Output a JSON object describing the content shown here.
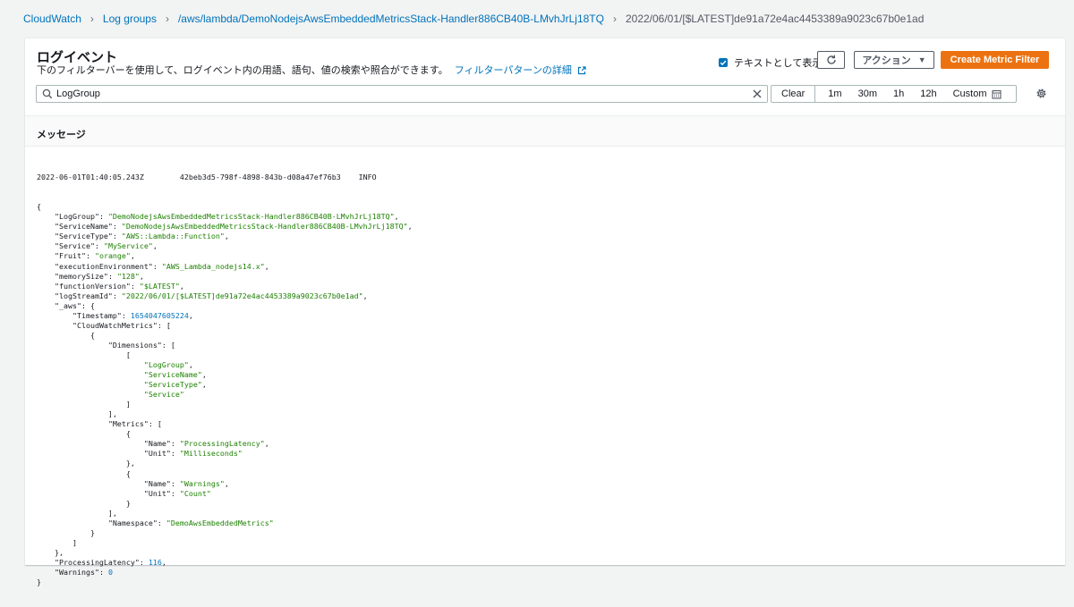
{
  "breadcrumb": {
    "items": [
      "CloudWatch",
      "Log groups",
      "/aws/lambda/DemoNodejsAwsEmbeddedMetricsStack-Handler886CB40B-LMvhJrLj18TQ"
    ],
    "current": "2022/06/01/[$LATEST]de91a72e4ac4453389a9023c67b0e1ad"
  },
  "header": {
    "title": "ログイベント",
    "description": "下のフィルターバーを使用して、ログイベント内の用語、語句、値の検索や照合ができます。",
    "learn_more": "フィルターパターンの詳細",
    "view_as_text": "テキストとして表示",
    "actions_label": "アクション",
    "create_metric_filter": "Create Metric Filter",
    "view_as_text_checked": true
  },
  "filter": {
    "value": "LogGroup",
    "time_buttons": [
      "Clear",
      "1m",
      "30m",
      "1h",
      "12h",
      "Custom"
    ]
  },
  "table": {
    "column": "メッセージ"
  },
  "log": {
    "timestamp": "2022-06-01T01:40:05.243Z",
    "request_id": "42beb3d5-798f-4898-843b-d08a47ef76b3",
    "level": "INFO",
    "lines": [
      [
        [
          "p",
          "{"
        ]
      ],
      [
        [
          "p",
          "    "
        ],
        [
          "k",
          "\"LogGroup\""
        ],
        [
          "p",
          ": "
        ],
        [
          "s",
          "\"DemoNodejsAwsEmbeddedMetricsStack-Handler886CB40B-LMvhJrLj18TQ\""
        ],
        [
          "p",
          ","
        ]
      ],
      [
        [
          "p",
          "    "
        ],
        [
          "k",
          "\"ServiceName\""
        ],
        [
          "p",
          ": "
        ],
        [
          "s",
          "\"DemoNodejsAwsEmbeddedMetricsStack-Handler886CB40B-LMvhJrLj18TQ\""
        ],
        [
          "p",
          ","
        ]
      ],
      [
        [
          "p",
          "    "
        ],
        [
          "k",
          "\"ServiceType\""
        ],
        [
          "p",
          ": "
        ],
        [
          "s",
          "\"AWS::Lambda::Function\""
        ],
        [
          "p",
          ","
        ]
      ],
      [
        [
          "p",
          "    "
        ],
        [
          "k",
          "\"Service\""
        ],
        [
          "p",
          ": "
        ],
        [
          "s",
          "\"MyService\""
        ],
        [
          "p",
          ","
        ]
      ],
      [
        [
          "p",
          "    "
        ],
        [
          "k",
          "\"Fruit\""
        ],
        [
          "p",
          ": "
        ],
        [
          "s",
          "\"orange\""
        ],
        [
          "p",
          ","
        ]
      ],
      [
        [
          "p",
          "    "
        ],
        [
          "k",
          "\"executionEnvironment\""
        ],
        [
          "p",
          ": "
        ],
        [
          "s",
          "\"AWS_Lambda_nodejs14.x\""
        ],
        [
          "p",
          ","
        ]
      ],
      [
        [
          "p",
          "    "
        ],
        [
          "k",
          "\"memorySize\""
        ],
        [
          "p",
          ": "
        ],
        [
          "s",
          "\"128\""
        ],
        [
          "p",
          ","
        ]
      ],
      [
        [
          "p",
          "    "
        ],
        [
          "k",
          "\"functionVersion\""
        ],
        [
          "p",
          ": "
        ],
        [
          "s",
          "\"$LATEST\""
        ],
        [
          "p",
          ","
        ]
      ],
      [
        [
          "p",
          "    "
        ],
        [
          "k",
          "\"logStreamId\""
        ],
        [
          "p",
          ": "
        ],
        [
          "s",
          "\"2022/06/01/[$LATEST]de91a72e4ac4453389a9023c67b0e1ad\""
        ],
        [
          "p",
          ","
        ]
      ],
      [
        [
          "p",
          "    "
        ],
        [
          "k",
          "\"_aws\""
        ],
        [
          "p",
          ": {"
        ]
      ],
      [
        [
          "p",
          "        "
        ],
        [
          "k",
          "\"Timestamp\""
        ],
        [
          "p",
          ": "
        ],
        [
          "n",
          "1654047605224"
        ],
        [
          "p",
          ","
        ]
      ],
      [
        [
          "p",
          "        "
        ],
        [
          "k",
          "\"CloudWatchMetrics\""
        ],
        [
          "p",
          ": ["
        ]
      ],
      [
        [
          "p",
          "            {"
        ]
      ],
      [
        [
          "p",
          "                "
        ],
        [
          "k",
          "\"Dimensions\""
        ],
        [
          "p",
          ": ["
        ]
      ],
      [
        [
          "p",
          "                    ["
        ]
      ],
      [
        [
          "p",
          "                        "
        ],
        [
          "s",
          "\"LogGroup\""
        ],
        [
          "p",
          ","
        ]
      ],
      [
        [
          "p",
          "                        "
        ],
        [
          "s",
          "\"ServiceName\""
        ],
        [
          "p",
          ","
        ]
      ],
      [
        [
          "p",
          "                        "
        ],
        [
          "s",
          "\"ServiceType\""
        ],
        [
          "p",
          ","
        ]
      ],
      [
        [
          "p",
          "                        "
        ],
        [
          "s",
          "\"Service\""
        ]
      ],
      [
        [
          "p",
          "                    ]"
        ]
      ],
      [
        [
          "p",
          "                ],"
        ]
      ],
      [
        [
          "p",
          "                "
        ],
        [
          "k",
          "\"Metrics\""
        ],
        [
          "p",
          ": ["
        ]
      ],
      [
        [
          "p",
          "                    {"
        ]
      ],
      [
        [
          "p",
          "                        "
        ],
        [
          "k",
          "\"Name\""
        ],
        [
          "p",
          ": "
        ],
        [
          "s",
          "\"ProcessingLatency\""
        ],
        [
          "p",
          ","
        ]
      ],
      [
        [
          "p",
          "                        "
        ],
        [
          "k",
          "\"Unit\""
        ],
        [
          "p",
          ": "
        ],
        [
          "s",
          "\"Milliseconds\""
        ]
      ],
      [
        [
          "p",
          "                    },"
        ]
      ],
      [
        [
          "p",
          "                    {"
        ]
      ],
      [
        [
          "p",
          "                        "
        ],
        [
          "k",
          "\"Name\""
        ],
        [
          "p",
          ": "
        ],
        [
          "s",
          "\"Warnings\""
        ],
        [
          "p",
          ","
        ]
      ],
      [
        [
          "p",
          "                        "
        ],
        [
          "k",
          "\"Unit\""
        ],
        [
          "p",
          ": "
        ],
        [
          "s",
          "\"Count\""
        ]
      ],
      [
        [
          "p",
          "                    }"
        ]
      ],
      [
        [
          "p",
          "                ],"
        ]
      ],
      [
        [
          "p",
          "                "
        ],
        [
          "k",
          "\"Namespace\""
        ],
        [
          "p",
          ": "
        ],
        [
          "s",
          "\"DemoAwsEmbeddedMetrics\""
        ]
      ],
      [
        [
          "p",
          "            }"
        ]
      ],
      [
        [
          "p",
          "        ]"
        ]
      ],
      [
        [
          "p",
          "    },"
        ]
      ],
      [
        [
          "p",
          "    "
        ],
        [
          "k",
          "\"ProcessingLatency\""
        ],
        [
          "p",
          ": "
        ],
        [
          "n",
          "116"
        ],
        [
          "p",
          ","
        ]
      ],
      [
        [
          "p",
          "    "
        ],
        [
          "k",
          "\"Warnings\""
        ],
        [
          "p",
          ": "
        ],
        [
          "n",
          "0"
        ]
      ],
      [
        [
          "p",
          "}"
        ]
      ]
    ]
  },
  "colors": {
    "link": "#0073bb",
    "primary_button": "#ec7211",
    "json_string": "#1d8102",
    "json_number": "#0073bb"
  },
  "icons": [
    "chevron-right-icon",
    "external-link-icon",
    "check-icon",
    "refresh-icon",
    "caret-down-icon",
    "search-icon",
    "clear-icon",
    "calendar-icon",
    "gear-icon"
  ]
}
